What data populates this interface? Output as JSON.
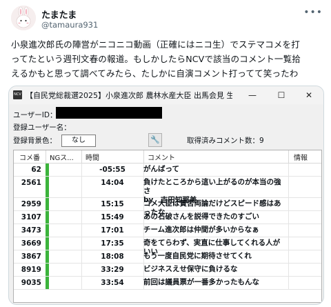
{
  "tweet": {
    "display_name": "たまたま",
    "handle": "@tamaura931",
    "more_icon": "more-horizontal-icon",
    "text": "小泉進次郎氏の陣営がニコニコ動画（正確にはニコ生）でステマコメを打\nってたという週刊文春の報道。もしかしたらNCVで該当のコメント一覧拾\nえるかもと思って調べてみたら、たしかに自演コメント打ってて笑ったわ"
  },
  "app": {
    "icon_label": "NCV",
    "title": "【自民党総裁選2025】小泉進次郎 農林水産大臣 出馬会見 生...",
    "minimize": "—",
    "maximize": "☐",
    "close": "✕",
    "user_id_label": "ユーザーID：",
    "registered_user_label": "登録ユーザー名：",
    "registered_bg_label": "登録背景色：",
    "bg_select_value": "なし",
    "wrench_icon": "wrench-icon",
    "fetched_count_label": "取得済みコメント数：9"
  },
  "table": {
    "headers": [
      "コメ番",
      "NGス...",
      "時間",
      "コメント",
      "情報"
    ],
    "rows": [
      {
        "no": "62",
        "time": "-05:55",
        "comment": "がんばって"
      },
      {
        "no": "2561",
        "time": "14:04",
        "comment": "負けたところから這い上がるのが本当の強さ\nby　吉田知那美"
      },
      {
        "no": "2959",
        "time": "15:15",
        "comment": "コメ大臣は賛否両論だけどスピード感はあったな"
      },
      {
        "no": "3107",
        "time": "15:49",
        "comment": "あの石破さんを説得できたのすごい"
      },
      {
        "no": "3473",
        "time": "17:01",
        "comment": "チーム進次郎は仲間が多いからなぁ"
      },
      {
        "no": "3669",
        "time": "17:35",
        "comment": "奇をてらわず、実直に仕事してくれる人がいい"
      },
      {
        "no": "3867",
        "time": "18:08",
        "comment": "もう一度自民党に期待させてくれ"
      },
      {
        "no": "8919",
        "time": "33:29",
        "comment": "ビジネスえせ保守に負けるな"
      },
      {
        "no": "9035",
        "time": "33:54",
        "comment": "前回は議員票が一番多かったもんな"
      }
    ]
  }
}
